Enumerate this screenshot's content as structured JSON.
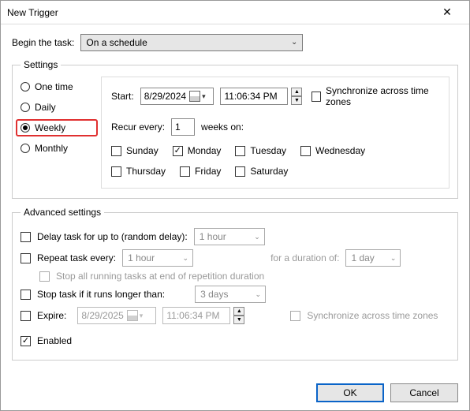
{
  "window": {
    "title": "New Trigger"
  },
  "begin": {
    "label": "Begin the task:",
    "value": "On a schedule"
  },
  "settings": {
    "legend": "Settings",
    "radios": {
      "one_time": "One time",
      "daily": "Daily",
      "weekly": "Weekly",
      "monthly": "Monthly",
      "selected": "weekly"
    },
    "start_label": "Start:",
    "start_date": "8/29/2024",
    "start_time": "11:06:34 PM",
    "sync_label": "Synchronize across time zones",
    "recur_label_pre": "Recur every:",
    "recur_value": "1",
    "recur_label_post": "weeks on:",
    "days": {
      "sun": "Sunday",
      "mon": "Monday",
      "tue": "Tuesday",
      "wed": "Wednesday",
      "thu": "Thursday",
      "fri": "Friday",
      "sat": "Saturday",
      "checked": [
        "mon"
      ]
    }
  },
  "advanced": {
    "legend": "Advanced settings",
    "delay_label": "Delay task for up to (random delay):",
    "delay_value": "1 hour",
    "repeat_label": "Repeat task every:",
    "repeat_value": "1 hour",
    "duration_label": "for a duration of:",
    "duration_value": "1 day",
    "stop_repetition_label": "Stop all running tasks at end of repetition duration",
    "stop_if_label": "Stop task if it runs longer than:",
    "stop_if_value": "3 days",
    "expire_label": "Expire:",
    "expire_date": "8/29/2025",
    "expire_time": "11:06:34 PM",
    "sync2_label": "Synchronize across time zones",
    "enabled_label": "Enabled"
  },
  "buttons": {
    "ok": "OK",
    "cancel": "Cancel"
  }
}
